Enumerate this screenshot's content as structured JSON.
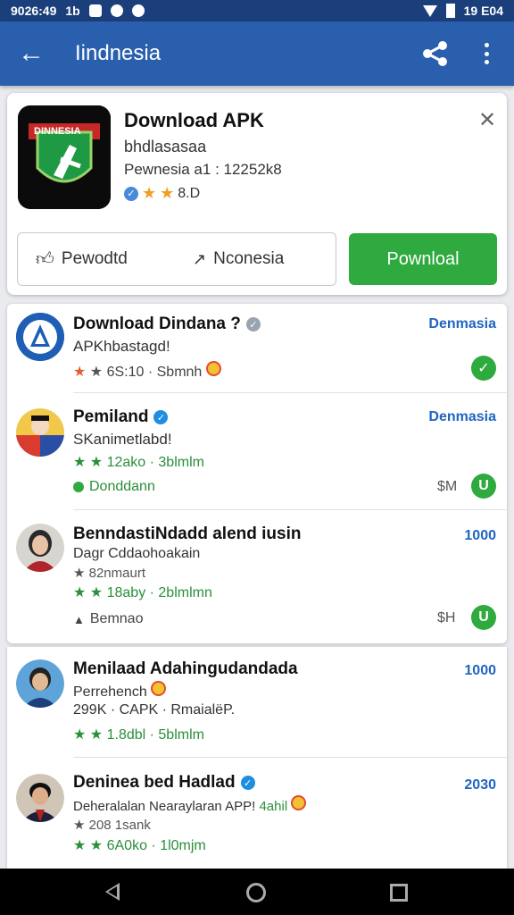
{
  "status_bar": {
    "time": "9026:49",
    "label": "1b",
    "right_text": "19 E04"
  },
  "app_bar": {
    "title": "Iindnesia"
  },
  "app_card": {
    "icon_label": "DINNESIA",
    "title": "Download APK",
    "subtitle": "bhdlasasaa",
    "meta": "Pewnesia a1 : 12252k8",
    "rating": "8.D",
    "button_left": "Pewodtd",
    "button_middle": "Nconesia",
    "button_primary": "Pownloal"
  },
  "list_items": [
    {
      "title": "Download Dindana ?",
      "subtitle": "APKhbastagd!",
      "rating": "6S:10",
      "size": "Sbmnh",
      "tag": "Denmasia"
    },
    {
      "title": "Pemiland",
      "subtitle": "SKanimetlabd!",
      "rating": "12ako",
      "size": "3blmlm",
      "tag": "Denmasia",
      "footer": "Donddann",
      "price": "$M"
    },
    {
      "title": "BenndastiNdadd alend iusin",
      "subtitle": "Dagr Cddaohoakain",
      "sub2": "★ 82nmaurt",
      "rating": "18aby",
      "size": "2blmlmn",
      "tag": "1000",
      "footer": "Bemnao",
      "price": "$H"
    },
    {
      "title": "Menilaad Adahingudandada",
      "subtitle": "Perrehench",
      "sub2": "299K · CAPK · RmaialëP.",
      "rating": "1.8dbl",
      "size": "5blmlm",
      "tag": "1000"
    },
    {
      "title": "Deninea bed Hadlad",
      "subtitle": "Deheralalan Nearaylaran APP! ",
      "subtitle_accent": "4ahil",
      "sub2": "★ 208 1sank",
      "rating": "6A0ko",
      "size": "1l0mjm",
      "tag": "2030"
    }
  ],
  "colors": {
    "app_bar": "#2a5fae",
    "status_bar": "#1b3f7a",
    "primary_green": "#2eaa3e",
    "tag_blue": "#1f66c1"
  }
}
